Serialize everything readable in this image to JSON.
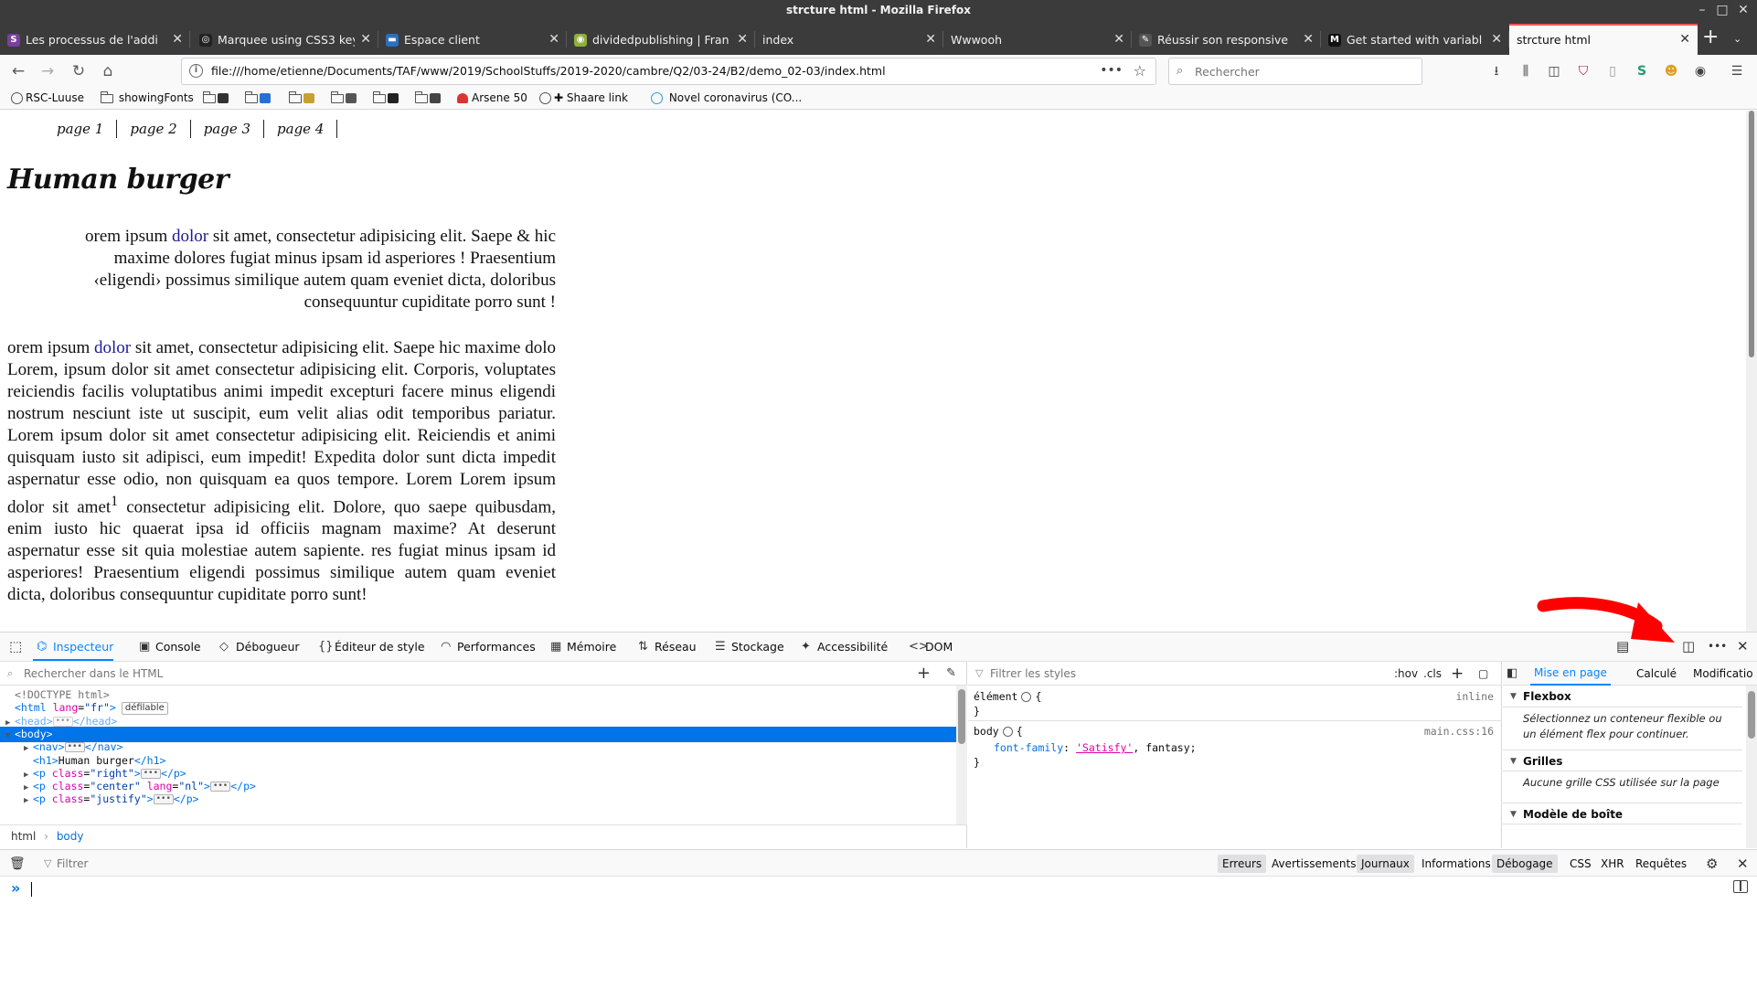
{
  "window": {
    "title": "strcture html - Mozilla Firefox",
    "controls": {
      "minimize": "–",
      "maximize": "□",
      "close": "✕"
    }
  },
  "tabs": [
    {
      "label": "Les processus de l'addi",
      "favicon_color": "#7b3fa0",
      "favicon": "S",
      "active": false
    },
    {
      "label": "Marquee using CSS3 key",
      "favicon_color": "#222222",
      "favicon": "◎",
      "active": false
    },
    {
      "label": "Espace client",
      "favicon_color": "#2c6fbf",
      "favicon": "▬",
      "active": false
    },
    {
      "label": "dividedpublishing | Fran",
      "favicon_color": "#8fae3c",
      "favicon": "◉",
      "active": false
    },
    {
      "label": "index",
      "favicon_color": "",
      "favicon": "",
      "active": false
    },
    {
      "label": "Wwwooh",
      "favicon_color": "",
      "favicon": "",
      "active": false
    },
    {
      "label": "Réussir son responsive",
      "favicon_color": "#555555",
      "favicon": "✎",
      "active": false
    },
    {
      "label": "Get started with variabl",
      "favicon_color": "#111111",
      "favicon": "M",
      "active": false
    },
    {
      "label": "strcture html",
      "favicon_color": "",
      "favicon": "",
      "active": true
    }
  ],
  "tab_close": "✕",
  "new_tab": "+",
  "tab_list": "⌄",
  "nav": {
    "back": "←",
    "forward": "→",
    "reload": "↻",
    "home": "⌂",
    "url": "file:///home/etienne/Documents/TAF/www/2019/SchoolStuffs/2019-2020/cambre/Q2/03-24/B2/demo_02-03/index.html",
    "page_actions": "•••",
    "star": "☆",
    "search_placeholder": "Rechercher",
    "search_icon": "🔍",
    "toolbar_icons": [
      "download-icon",
      "library-icon",
      "sidebar-icon",
      "ublock-icon",
      "reader-icon",
      "sync-icon",
      "extension-icon",
      "account-icon",
      "menu-icon"
    ]
  },
  "bookmarks": {
    "items": [
      {
        "label": "RSC-Luuse",
        "icon": "globe-icon"
      },
      {
        "label": "showingFonts",
        "icon": "folder-icon"
      },
      {
        "label": "",
        "icon": "folder-icon"
      },
      {
        "label": "",
        "icon": "folder-icon"
      },
      {
        "label": "",
        "icon": "folder-icon"
      },
      {
        "label": "",
        "icon": "folder-icon"
      },
      {
        "label": "",
        "icon": "folder-icon"
      },
      {
        "label": "",
        "icon": "folder-icon"
      },
      {
        "label": "Arsene 50",
        "icon": "bookmark-icon"
      },
      {
        "label": "Shaare link",
        "icon": "globe-icon"
      },
      {
        "label": "Novel coronavirus (CO...",
        "icon": "who-icon"
      }
    ]
  },
  "page": {
    "nav_links": [
      "page 1",
      "page 2",
      "page 3",
      "page 4"
    ],
    "heading": "Human burger",
    "p_right": {
      "before": "orem ipsum ",
      "link": "dolor",
      "after": " sit amet, consectetur adipisicing elit. Saepe & hic maxime dolores fugiat minus ipsam id asperiores ! Praesentium ‹eligendi› possimus similique autem quam eveniet dicta, doloribus consequuntur cupiditate porro sunt !"
    },
    "p_justify": {
      "before": "orem ipsum ",
      "link": "dolor",
      "after": " sit amet, consectetur adipisicing elit. Saepe hic maxime dolo Lorem, ipsum dolor sit amet consectetur adipisicing elit. Corporis, voluptates reiciendis facilis voluptatibus animi impedit excepturi facere minus eligendi nostrum nesciunt iste ut suscipit, eum velit alias odit temporibus pariatur. Lorem ipsum dolor sit amet consectetur adipisicing elit. Reiciendis et animi quisquam iusto sit adipisci, eum impedit! Expedita dolor sunt dicta impedit aspernatur esse odio, non quisquam ea quos tempore. Lorem Lorem ipsum dolor sit amet",
      "sup": "1",
      "rest": " consectetur adipisicing elit. Dolore, quo saepe quibusdam, enim iusto hic quaerat ipsa id officiis magnam maxime? At deserunt aspernatur esse sit quia molestiae autem sapiente. res fugiat minus ipsam id asperiores! Praesentium eligendi possimus similique autem quam eveniet dicta, doloribus consequuntur cupiditate porro sunt!"
    }
  },
  "devtools": {
    "tabs": [
      {
        "label": "Inspecteur",
        "icon": "⌬",
        "active": true
      },
      {
        "label": "Console",
        "icon": "▣",
        "active": false
      },
      {
        "label": "Débogueur",
        "icon": "◇",
        "active": false
      },
      {
        "label": "Éditeur de style",
        "icon": "{}",
        "active": false
      },
      {
        "label": "Performances",
        "icon": "◠",
        "active": false
      },
      {
        "label": "Mémoire",
        "icon": "▦",
        "active": false
      },
      {
        "label": "Réseau",
        "icon": "⇅",
        "active": false
      },
      {
        "label": "Stockage",
        "icon": "☰",
        "active": false
      },
      {
        "label": "Accessibilité",
        "icon": "✦",
        "active": false
      },
      {
        "label": "DOM",
        "icon": "<>",
        "active": false
      }
    ],
    "picker_icon": "⬚",
    "right_icons": {
      "frames": "▤",
      "dock": "◫",
      "more": "•••",
      "close": "✕"
    },
    "markup": {
      "search_placeholder": "Rechercher dans le HTML",
      "add": "+",
      "eyedropper": "✎",
      "lines": [
        {
          "indent": 1,
          "twisty": "",
          "html": "<!DOCTYPE html>",
          "kind": "doctype"
        },
        {
          "indent": 1,
          "twisty": "",
          "tag": "html",
          "attrs": [
            [
              "lang",
              "fr"
            ]
          ],
          "suffix": ">",
          "badge": "défilable"
        },
        {
          "indent": 1,
          "twisty": "▶",
          "tag": "head",
          "collapsed": true,
          "faded": true
        },
        {
          "indent": 1,
          "twisty": "▼",
          "tag": "body",
          "selected": true
        },
        {
          "indent": 2,
          "twisty": "▶",
          "tag": "nav",
          "collapsed": true
        },
        {
          "indent": 2,
          "twisty": "",
          "tag": "h1",
          "text": "Human burger"
        },
        {
          "indent": 2,
          "twisty": "▶",
          "tag": "p",
          "attrs": [
            [
              "class",
              "right"
            ]
          ],
          "collapsed": true
        },
        {
          "indent": 2,
          "twisty": "▶",
          "tag": "p",
          "attrs": [
            [
              "class",
              "center"
            ],
            [
              "lang",
              "nl"
            ]
          ],
          "collapsed": true
        },
        {
          "indent": 2,
          "twisty": "▶",
          "tag": "p",
          "attrs": [
            [
              "class",
              "justify"
            ]
          ],
          "collapsed": true
        }
      ],
      "breadcrumbs": [
        "html",
        "body"
      ],
      "crumb_sep": "›"
    },
    "rules": {
      "filter_placeholder": "Filtrer les styles",
      "buttons": [
        ":hov",
        ".cls",
        "+",
        "▢"
      ],
      "element_selector": "élément",
      "element_source": "inline",
      "body_selector": "body",
      "body_source": "main.css:16",
      "property": "font-family",
      "value_font": "'Satisfy'",
      "value_rest": ", fantasy;"
    },
    "layout": {
      "tabs": [
        "Mise en page",
        "Calculé",
        "Modificatio"
      ],
      "sections": [
        {
          "title": "Flexbox",
          "message": "Sélectionnez un conteneur flexible ou un élément flex pour continuer."
        },
        {
          "title": "Grilles",
          "message": "Aucune grille CSS utilisée sur la page"
        },
        {
          "title": "Modèle de boîte",
          "message": ""
        }
      ]
    },
    "console": {
      "filter_placeholder": "Filtrer",
      "filters": [
        {
          "label": "Erreurs",
          "on": true
        },
        {
          "label": "Avertissements",
          "on": false
        },
        {
          "label": "Journaux",
          "on": true
        },
        {
          "label": "Informations",
          "on": false
        },
        {
          "label": "Débogage",
          "on": true
        },
        {
          "label": "CSS",
          "on": false
        },
        {
          "label": "XHR",
          "on": false
        },
        {
          "label": "Requêtes",
          "on": false
        }
      ],
      "prompt": "»"
    }
  },
  "colors": {
    "accent": "#0a84ff",
    "selection": "#0074e8",
    "active_tab_line": "#ff5555",
    "annotation_arrow": "#ff0000"
  }
}
